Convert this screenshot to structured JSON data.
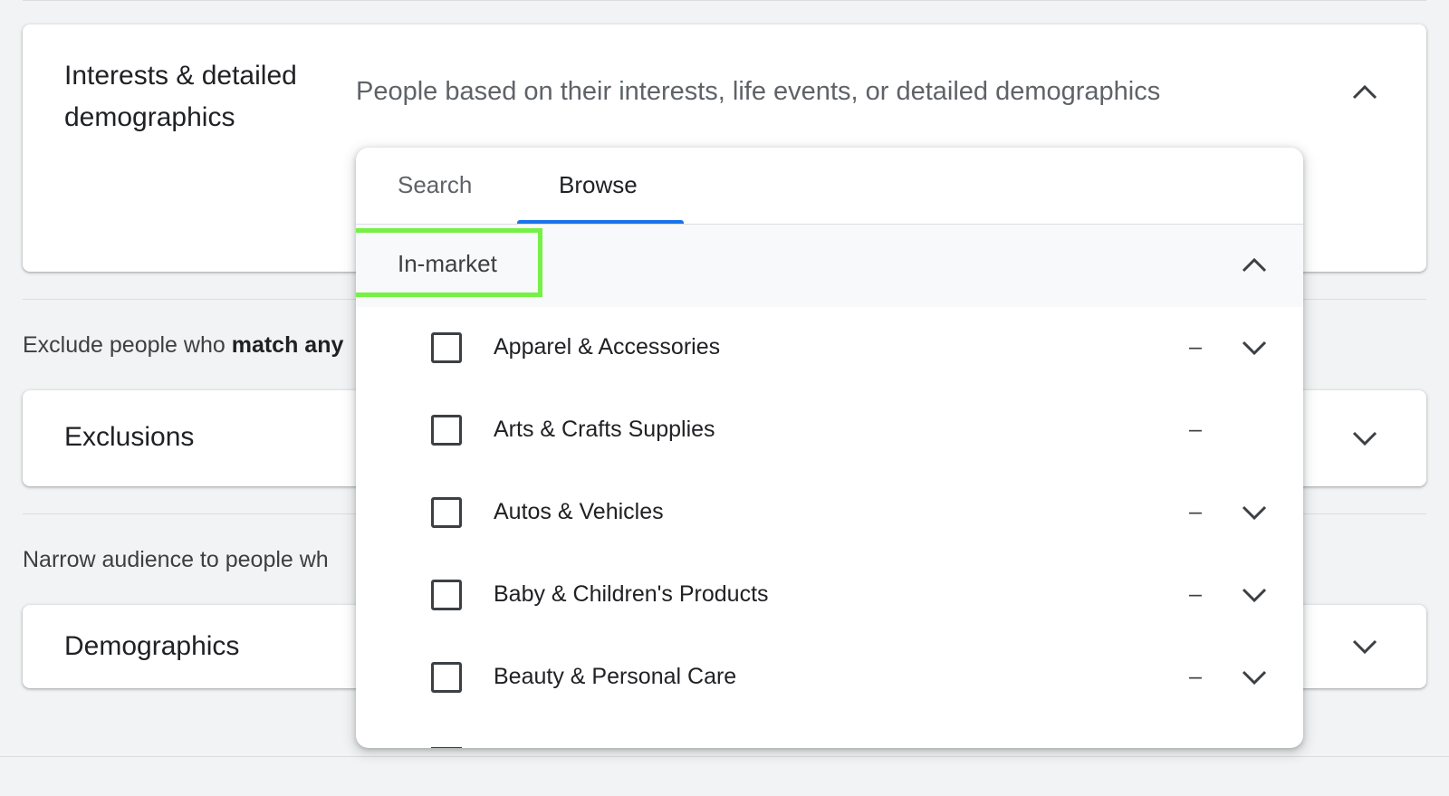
{
  "interests": {
    "title_line1": "Interests & detailed",
    "title_line2": "demographics",
    "description": "People based on their interests, life events, or detailed demographics"
  },
  "exclude_text": {
    "prefix": "Exclude people who ",
    "bold": "match any"
  },
  "exclusions": {
    "title": "Exclusions"
  },
  "narrow_text": "Narrow audience to people wh",
  "demographics": {
    "title": "Demographics"
  },
  "popover": {
    "tabs": [
      {
        "label": "Search",
        "selected": false
      },
      {
        "label": "Browse",
        "selected": true
      }
    ],
    "section": {
      "label": "In-market"
    },
    "items": [
      {
        "label": "Apparel & Accessories",
        "indicator": "–",
        "has_expand": true
      },
      {
        "label": "Arts & Crafts Supplies",
        "indicator": "–",
        "has_expand": false
      },
      {
        "label": "Autos & Vehicles",
        "indicator": "–",
        "has_expand": true
      },
      {
        "label": "Baby & Children's Products",
        "indicator": "–",
        "has_expand": true
      },
      {
        "label": "Beauty & Personal Care",
        "indicator": "–",
        "has_expand": true
      }
    ]
  },
  "colors": {
    "accent": "#1a73e8",
    "highlight": "#76f046",
    "background": "#f1f3f4"
  },
  "icons": {
    "collapse": "chevron-up-icon",
    "expand": "chevron-down-icon",
    "checkbox": "checkbox-unchecked"
  }
}
